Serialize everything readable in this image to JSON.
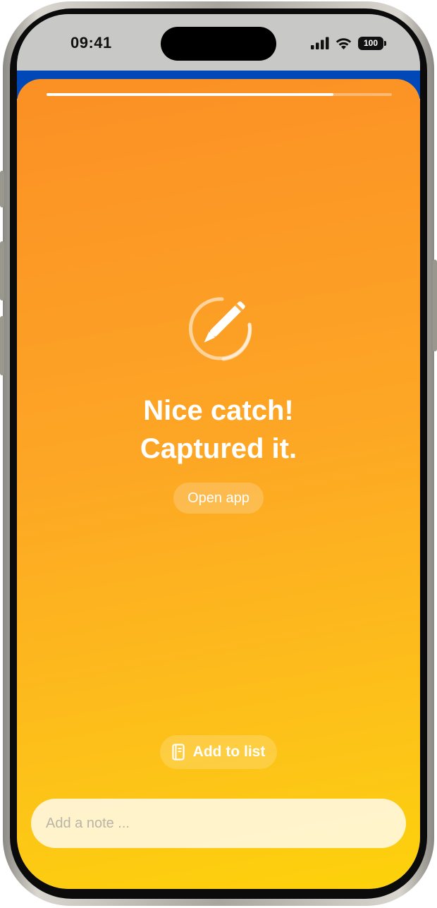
{
  "status_bar": {
    "time": "09:41",
    "battery": "100",
    "icons": [
      "signal-icon",
      "wifi-icon",
      "battery-icon"
    ]
  },
  "progress": {
    "value": 0.83
  },
  "confirmation": {
    "icon": "pencil-circle-icon",
    "title_line1": "Nice catch!",
    "title_line2": "Captured it.",
    "open_app_label": "Open app"
  },
  "actions": {
    "add_to_list_label": "Add to list",
    "add_to_list_icon": "notebook-icon"
  },
  "note_input": {
    "placeholder": "Add a note ...",
    "value": ""
  },
  "colors": {
    "gradient_top": "#fb8f25",
    "gradient_bottom": "#fdd20a",
    "header_band": "#0047b8",
    "text": "#ffffff"
  }
}
